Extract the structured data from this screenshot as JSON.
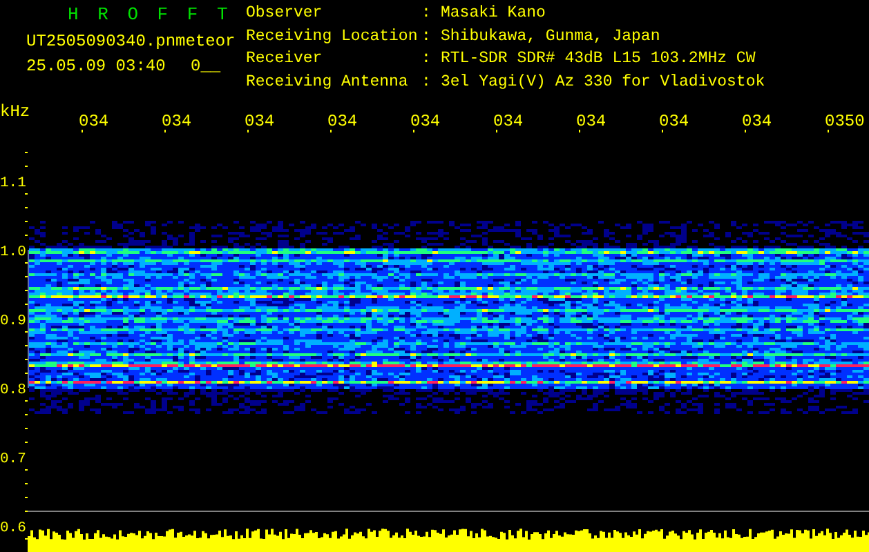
{
  "header": {
    "title": "H R O F F T",
    "file_name": "UT2505090340.pn",
    "mode": "meteor",
    "date_time": "25.05.09 03:40",
    "counter": "0__",
    "info": [
      {
        "label": "Observer",
        "separator": ":",
        "value": "Masaki Kano"
      },
      {
        "label": "Receiving Location",
        "separator": ":",
        "value": "Shibukawa, Gunma, Japan"
      },
      {
        "label": "Receiver",
        "separator": ":",
        "value": "RTL-SDR SDR# 43dB L15 103.2MHz CW"
      },
      {
        "label": "Receiving Antenna",
        "separator": ":",
        "value": "3el Yagi(V) Az 330 for Vladivostok"
      }
    ]
  },
  "spectrogram": {
    "unit": "kHz",
    "time_labels": [
      "034",
      "034",
      "034",
      "034",
      "034",
      "034",
      "034",
      "034",
      "034",
      "0350"
    ],
    "frequency_labels": [
      "1.1",
      "1.0",
      "0.9",
      "0.8",
      "0.7",
      "0.6"
    ]
  }
}
